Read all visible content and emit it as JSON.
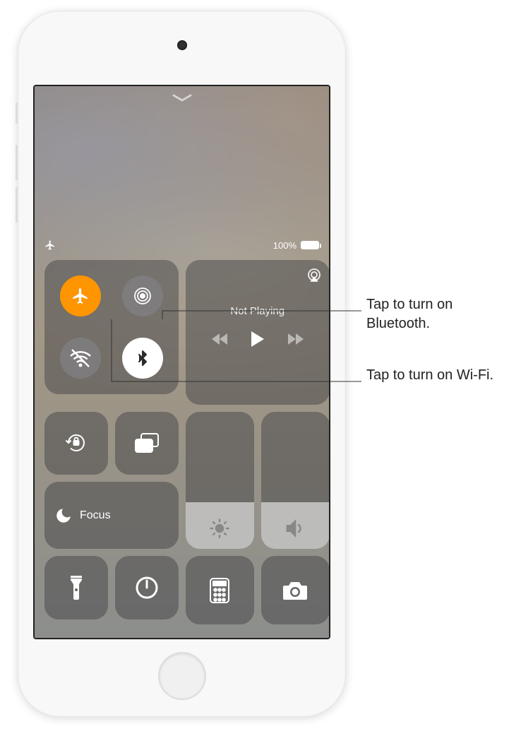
{
  "status": {
    "battery_percent": "100%"
  },
  "media": {
    "title": "Not Playing"
  },
  "focus": {
    "label": "Focus"
  },
  "callouts": {
    "bluetooth": "Tap to turn on Bluetooth.",
    "wifi": "Tap to turn on Wi-Fi."
  },
  "colors": {
    "airplane_active": "#ff9500"
  }
}
